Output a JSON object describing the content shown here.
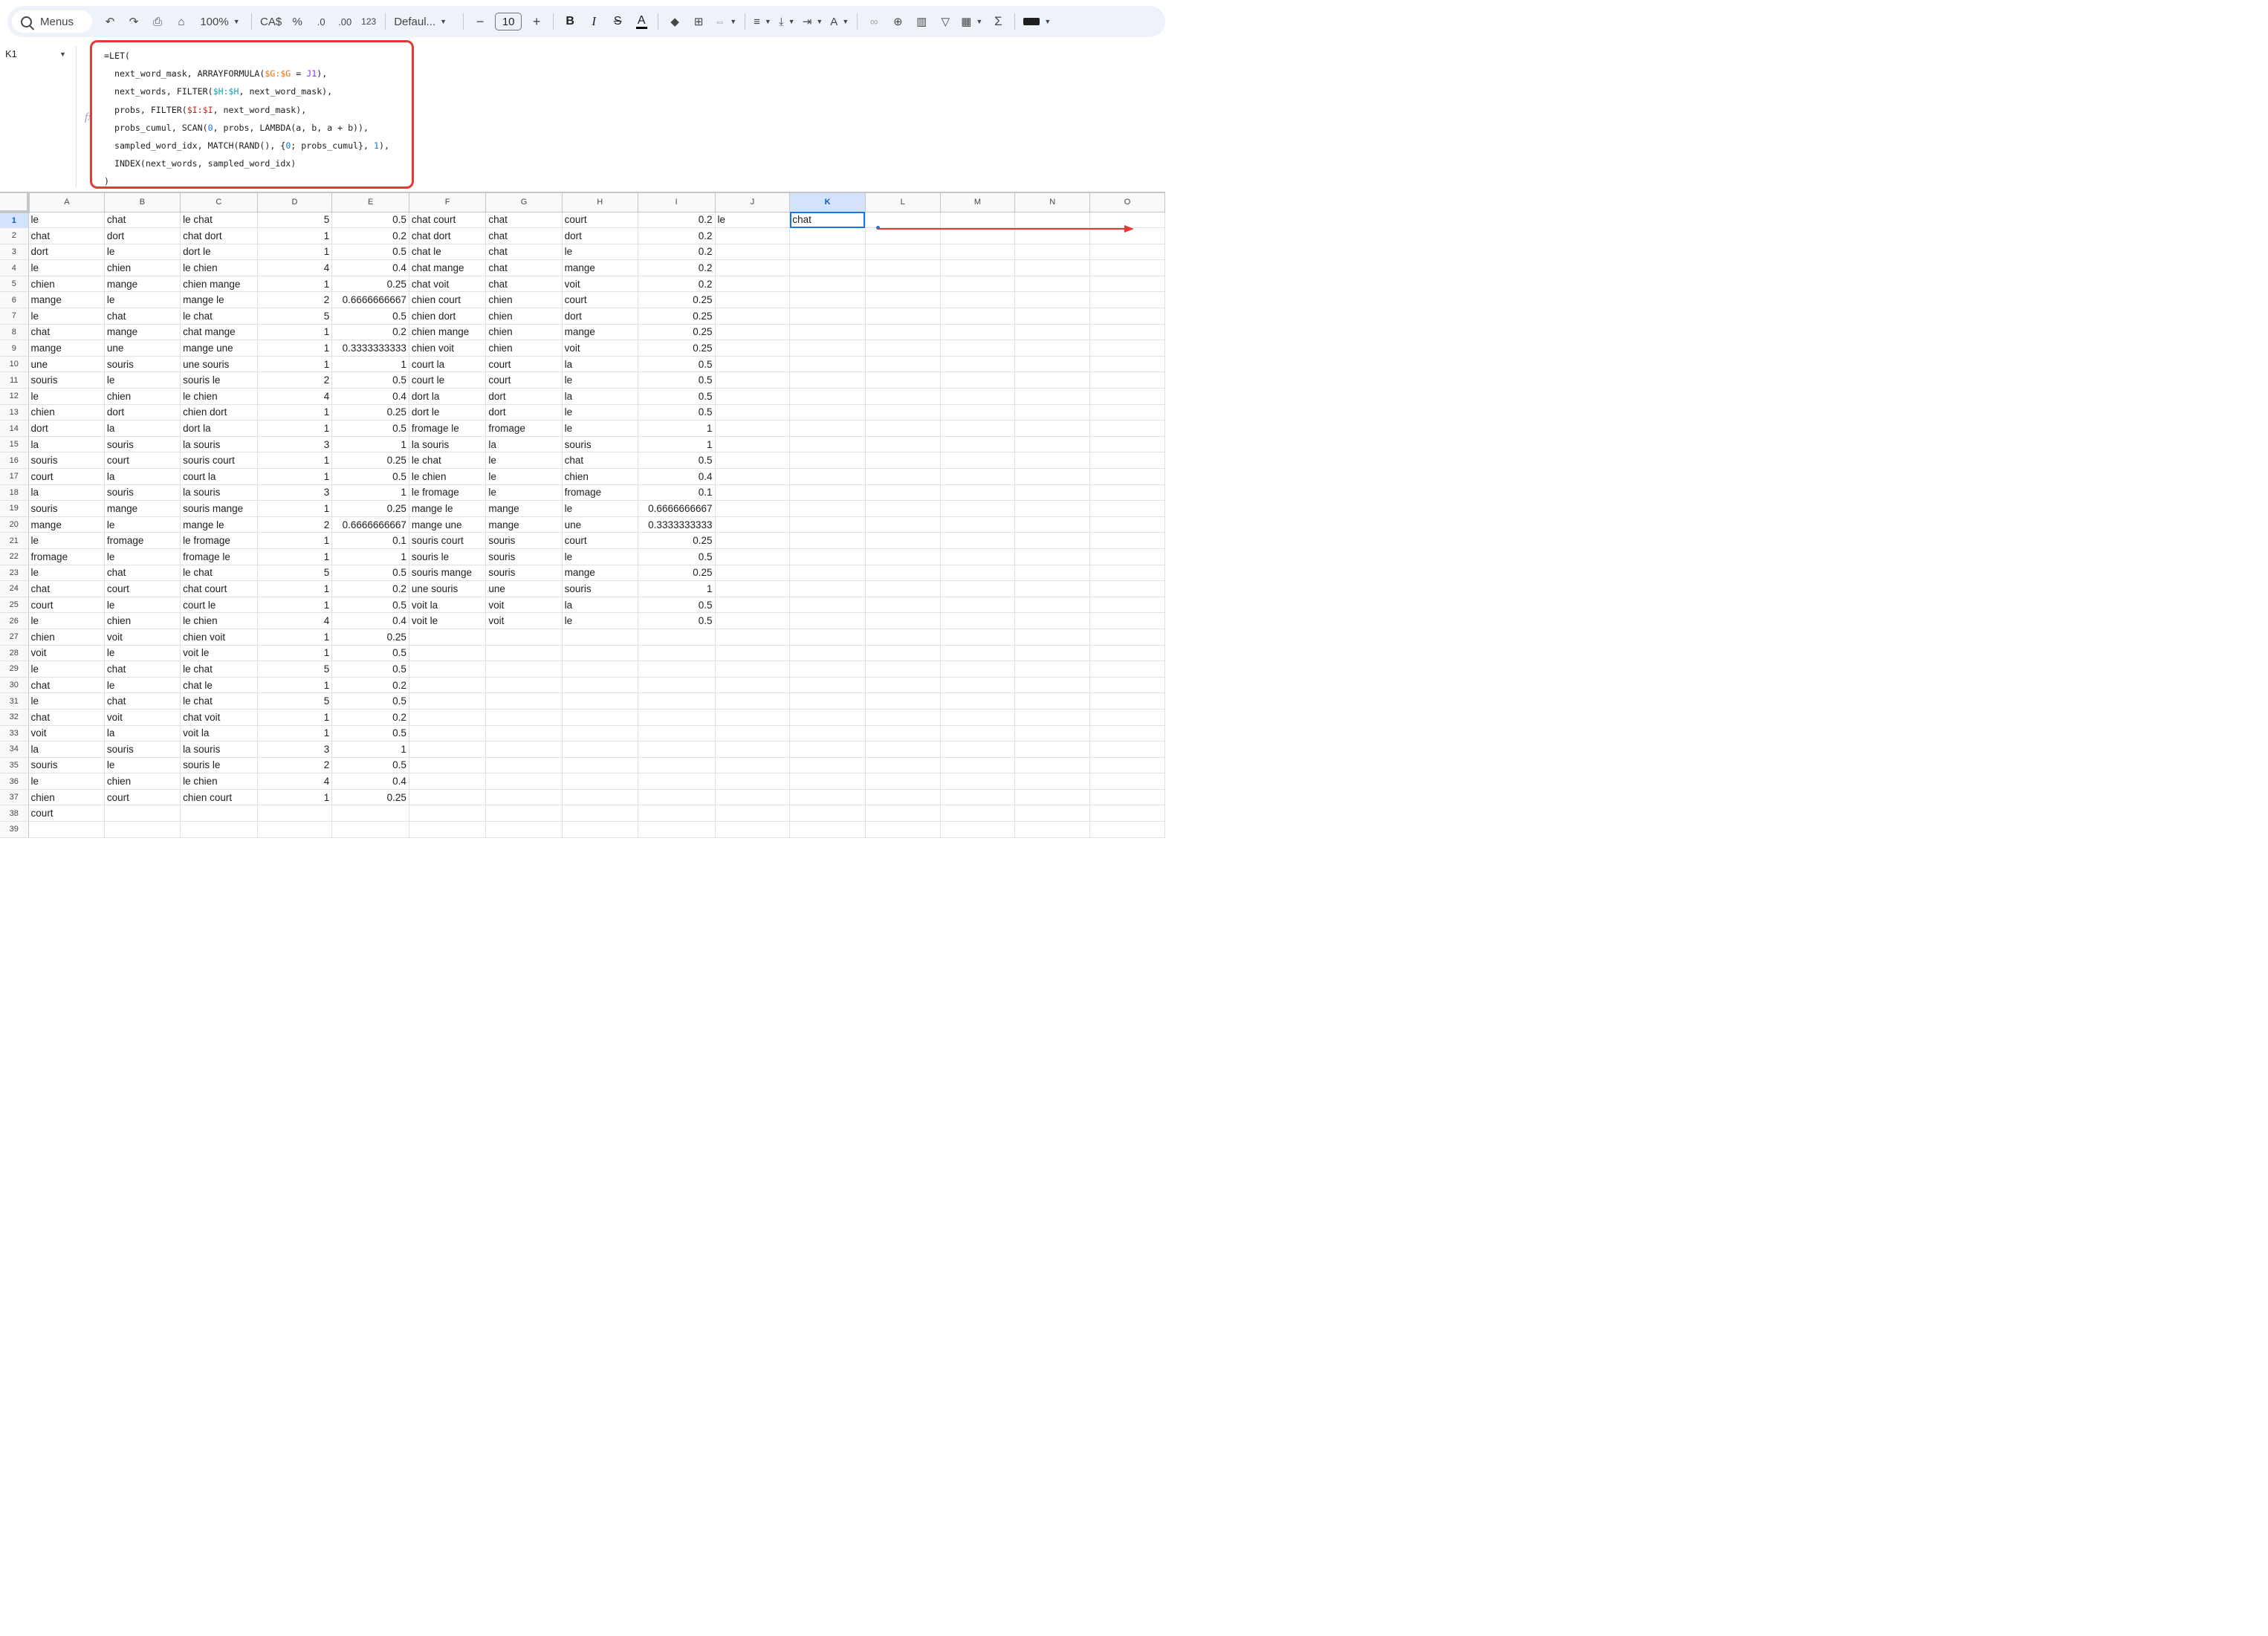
{
  "toolbar": {
    "menus_label": "Menus",
    "zoom": "100%",
    "currency": "CA$",
    "percent": "%",
    "decrease_decimal": ".0",
    "increase_decimal": ".00",
    "number_format": "123",
    "font_family": "Defaul...",
    "font_size": "10",
    "bold": "B",
    "italic": "I",
    "strikethrough": "S",
    "text_color": "A",
    "text_rotation": "A",
    "sum": "Σ",
    "minus": "−",
    "plus": "+"
  },
  "formula_bar": {
    "cell_ref": "K1",
    "fx": "fx",
    "line1": "=LET(",
    "line2_a": "  next_word_mask, ARRAYFORMULA(",
    "line2_ref1": "$G:$G",
    "line2_b": " = ",
    "line2_ref2": "J1",
    "line2_c": "),",
    "line3_a": "  next_words, FILTER(",
    "line3_ref": "$H:$H",
    "line3_b": ", next_word_mask),",
    "line4_a": "  probs, FILTER(",
    "line4_ref": "$I:$I",
    "line4_b": ", next_word_mask),",
    "line5_a": "  probs_cumul, SCAN(",
    "line5_num": "0",
    "line5_b": ", probs, LAMBDA(a, b, a + b)),",
    "line6_a": "  sampled_word_idx, MATCH(RAND(), {",
    "line6_num1": "0",
    "line6_b": "; probs_cumul}, ",
    "line6_num2": "1",
    "line6_c": "),",
    "line7": "  INDEX(next_words, sampled_word_idx)",
    "line8": ")"
  },
  "columns": [
    "A",
    "B",
    "C",
    "D",
    "E",
    "F",
    "G",
    "H",
    "I",
    "J",
    "K",
    "L",
    "M",
    "N",
    "O"
  ],
  "rows": [
    [
      "le",
      "chat",
      "le chat",
      "5",
      "0.5",
      "chat court",
      "chat",
      "court",
      "0.2",
      "le",
      "chat",
      "",
      "",
      "",
      ""
    ],
    [
      "chat",
      "dort",
      "chat dort",
      "1",
      "0.2",
      "chat dort",
      "chat",
      "dort",
      "0.2",
      "",
      "",
      "",
      "",
      "",
      ""
    ],
    [
      "dort",
      "le",
      "dort le",
      "1",
      "0.5",
      "chat le",
      "chat",
      "le",
      "0.2",
      "",
      "",
      "",
      "",
      "",
      ""
    ],
    [
      "le",
      "chien",
      "le chien",
      "4",
      "0.4",
      "chat mange",
      "chat",
      "mange",
      "0.2",
      "",
      "",
      "",
      "",
      "",
      ""
    ],
    [
      "chien",
      "mange",
      "chien mange",
      "1",
      "0.25",
      "chat voit",
      "chat",
      "voit",
      "0.2",
      "",
      "",
      "",
      "",
      "",
      ""
    ],
    [
      "mange",
      "le",
      "mange le",
      "2",
      "0.6666666667",
      "chien court",
      "chien",
      "court",
      "0.25",
      "",
      "",
      "",
      "",
      "",
      ""
    ],
    [
      "le",
      "chat",
      "le chat",
      "5",
      "0.5",
      "chien dort",
      "chien",
      "dort",
      "0.25",
      "",
      "",
      "",
      "",
      "",
      ""
    ],
    [
      "chat",
      "mange",
      "chat mange",
      "1",
      "0.2",
      "chien mange",
      "chien",
      "mange",
      "0.25",
      "",
      "",
      "",
      "",
      "",
      ""
    ],
    [
      "mange",
      "une",
      "mange une",
      "1",
      "0.3333333333",
      "chien voit",
      "chien",
      "voit",
      "0.25",
      "",
      "",
      "",
      "",
      "",
      ""
    ],
    [
      "une",
      "souris",
      "une souris",
      "1",
      "1",
      "court la",
      "court",
      "la",
      "0.5",
      "",
      "",
      "",
      "",
      "",
      ""
    ],
    [
      "souris",
      "le",
      "souris le",
      "2",
      "0.5",
      "court le",
      "court",
      "le",
      "0.5",
      "",
      "",
      "",
      "",
      "",
      ""
    ],
    [
      "le",
      "chien",
      "le chien",
      "4",
      "0.4",
      "dort la",
      "dort",
      "la",
      "0.5",
      "",
      "",
      "",
      "",
      "",
      ""
    ],
    [
      "chien",
      "dort",
      "chien dort",
      "1",
      "0.25",
      "dort le",
      "dort",
      "le",
      "0.5",
      "",
      "",
      "",
      "",
      "",
      ""
    ],
    [
      "dort",
      "la",
      "dort la",
      "1",
      "0.5",
      "fromage le",
      "fromage",
      "le",
      "1",
      "",
      "",
      "",
      "",
      "",
      ""
    ],
    [
      "la",
      "souris",
      "la souris",
      "3",
      "1",
      "la souris",
      "la",
      "souris",
      "1",
      "",
      "",
      "",
      "",
      "",
      ""
    ],
    [
      "souris",
      "court",
      "souris court",
      "1",
      "0.25",
      "le chat",
      "le",
      "chat",
      "0.5",
      "",
      "",
      "",
      "",
      "",
      ""
    ],
    [
      "court",
      "la",
      "court la",
      "1",
      "0.5",
      "le chien",
      "le",
      "chien",
      "0.4",
      "",
      "",
      "",
      "",
      "",
      ""
    ],
    [
      "la",
      "souris",
      "la souris",
      "3",
      "1",
      "le fromage",
      "le",
      "fromage",
      "0.1",
      "",
      "",
      "",
      "",
      "",
      ""
    ],
    [
      "souris",
      "mange",
      "souris mange",
      "1",
      "0.25",
      "mange le",
      "mange",
      "le",
      "0.6666666667",
      "",
      "",
      "",
      "",
      "",
      ""
    ],
    [
      "mange",
      "le",
      "mange le",
      "2",
      "0.6666666667",
      "mange une",
      "mange",
      "une",
      "0.3333333333",
      "",
      "",
      "",
      "",
      "",
      ""
    ],
    [
      "le",
      "fromage",
      "le fromage",
      "1",
      "0.1",
      "souris court",
      "souris",
      "court",
      "0.25",
      "",
      "",
      "",
      "",
      "",
      ""
    ],
    [
      "fromage",
      "le",
      "fromage le",
      "1",
      "1",
      "souris le",
      "souris",
      "le",
      "0.5",
      "",
      "",
      "",
      "",
      "",
      ""
    ],
    [
      "le",
      "chat",
      "le chat",
      "5",
      "0.5",
      "souris mange",
      "souris",
      "mange",
      "0.25",
      "",
      "",
      "",
      "",
      "",
      ""
    ],
    [
      "chat",
      "court",
      "chat court",
      "1",
      "0.2",
      "une souris",
      "une",
      "souris",
      "1",
      "",
      "",
      "",
      "",
      "",
      ""
    ],
    [
      "court",
      "le",
      "court le",
      "1",
      "0.5",
      "voit la",
      "voit",
      "la",
      "0.5",
      "",
      "",
      "",
      "",
      "",
      ""
    ],
    [
      "le",
      "chien",
      "le chien",
      "4",
      "0.4",
      "voit le",
      "voit",
      "le",
      "0.5",
      "",
      "",
      "",
      "",
      "",
      ""
    ],
    [
      "chien",
      "voit",
      "chien voit",
      "1",
      "0.25",
      "",
      "",
      "",
      "",
      "",
      "",
      "",
      "",
      "",
      ""
    ],
    [
      "voit",
      "le",
      "voit le",
      "1",
      "0.5",
      "",
      "",
      "",
      "",
      "",
      "",
      "",
      "",
      "",
      ""
    ],
    [
      "le",
      "chat",
      "le chat",
      "5",
      "0.5",
      "",
      "",
      "",
      "",
      "",
      "",
      "",
      "",
      "",
      ""
    ],
    [
      "chat",
      "le",
      "chat le",
      "1",
      "0.2",
      "",
      "",
      "",
      "",
      "",
      "",
      "",
      "",
      "",
      ""
    ],
    [
      "le",
      "chat",
      "le chat",
      "5",
      "0.5",
      "",
      "",
      "",
      "",
      "",
      "",
      "",
      "",
      "",
      ""
    ],
    [
      "chat",
      "voit",
      "chat voit",
      "1",
      "0.2",
      "",
      "",
      "",
      "",
      "",
      "",
      "",
      "",
      "",
      ""
    ],
    [
      "voit",
      "la",
      "voit la",
      "1",
      "0.5",
      "",
      "",
      "",
      "",
      "",
      "",
      "",
      "",
      "",
      ""
    ],
    [
      "la",
      "souris",
      "la souris",
      "3",
      "1",
      "",
      "",
      "",
      "",
      "",
      "",
      "",
      "",
      "",
      ""
    ],
    [
      "souris",
      "le",
      "souris le",
      "2",
      "0.5",
      "",
      "",
      "",
      "",
      "",
      "",
      "",
      "",
      "",
      ""
    ],
    [
      "le",
      "chien",
      "le chien",
      "4",
      "0.4",
      "",
      "",
      "",
      "",
      "",
      "",
      "",
      "",
      "",
      ""
    ],
    [
      "chien",
      "court",
      "chien court",
      "1",
      "0.25",
      "",
      "",
      "",
      "",
      "",
      "",
      "",
      "",
      "",
      ""
    ],
    [
      "court",
      "",
      "",
      "",
      "",
      "",
      "",
      "",
      "",
      "",
      "",
      "",
      "",
      "",
      ""
    ],
    [
      "",
      "",
      "",
      "",
      "",
      "",
      "",
      "",
      "",
      "",
      "",
      "",
      "",
      "",
      ""
    ]
  ],
  "selection": {
    "cell": "K1",
    "row": 1,
    "col": "K"
  },
  "colors": {
    "accent": "#1a73e8",
    "highlight_border": "#e53935",
    "selected_header": "#d3e3fd"
  }
}
